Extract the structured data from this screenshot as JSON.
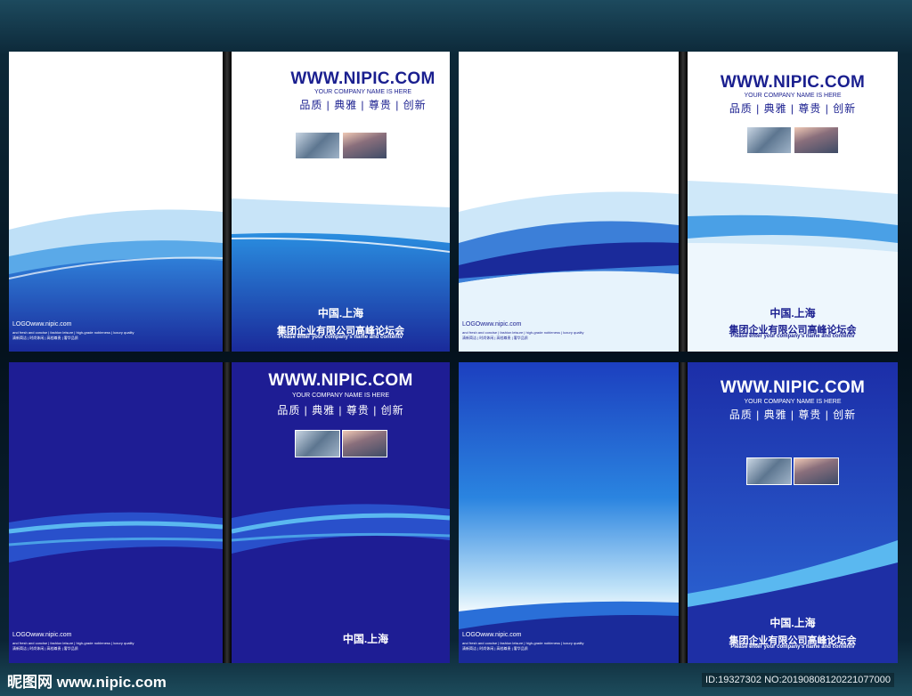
{
  "cover": {
    "url": "WWW.NIPIC.COM",
    "company_placeholder": "YOUR COMPANY NAME IS HERE",
    "tagline": "品质 | 典雅 | 尊贵 | 创新",
    "city": "中国.上海",
    "corp_title": "集团企业有限公司高峰论坛会",
    "corp_subtitle": "Please enter your company's name and contentv",
    "logo_text": "LOGOwww.nipic.com",
    "small_en": "and fresh and concise | fashion leisure | high-grade nobleness | luxury quality",
    "small_cn": "清新简洁 | 时尚休闲 | 高档尊贵 | 奢华品质"
  },
  "colors": {
    "navy": "#1a1f8f",
    "blue": "#1b55c8",
    "light": "#4aa8ea"
  },
  "footer": {
    "watermark": "昵图网 www.nipic.com",
    "id_text": "ID:19327302 NO:20190808120221077000"
  }
}
